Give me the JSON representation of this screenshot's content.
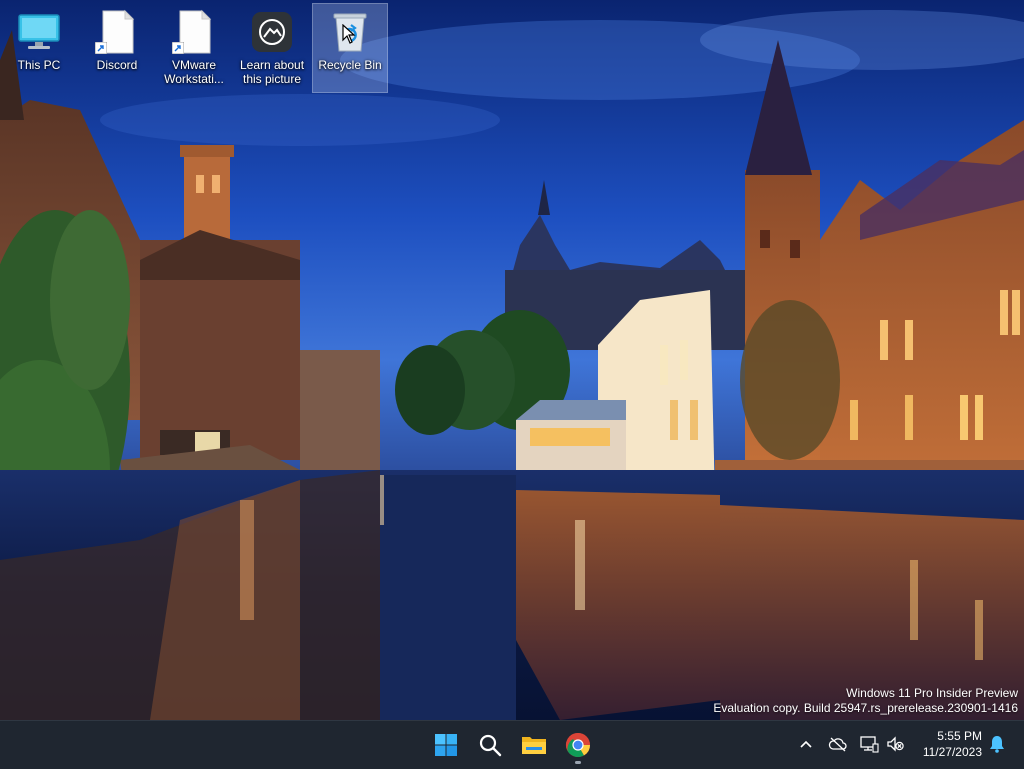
{
  "desktop": {
    "icons": [
      {
        "label": "This PC",
        "icon": "this-pc-icon"
      },
      {
        "label": "Discord",
        "icon": "file-shortcut-icon"
      },
      {
        "label": "VMware Workstati...",
        "icon": "file-shortcut-icon"
      },
      {
        "label": "Learn about this picture",
        "icon": "camera-icon"
      },
      {
        "label": "Recycle Bin",
        "icon": "recycle-bin-icon",
        "selected": true
      }
    ]
  },
  "watermark": {
    "line1": "Windows 11 Pro Insider Preview",
    "line2": "Evaluation copy. Build 25947.rs_prerelease.230901-1416"
  },
  "taskbar": {
    "apps": [
      {
        "name": "Start",
        "icon": "windows-start-icon"
      },
      {
        "name": "Search",
        "icon": "search-icon"
      },
      {
        "name": "File Explorer",
        "icon": "folder-icon"
      },
      {
        "name": "Google Chrome",
        "icon": "chrome-icon",
        "running": true
      }
    ],
    "tray": {
      "icons": [
        "chevron-up-icon",
        "network-icon",
        "volume-muted-icon",
        "notifications-icon"
      ]
    },
    "clock": {
      "time": "5:55 PM",
      "date": "11/27/2023"
    }
  },
  "colors": {
    "taskbar_bg": "#1f2630",
    "sky_top": "#0b2a7a",
    "sky_bottom": "#3a6fd8",
    "accent_blue": "#2f8fff"
  }
}
